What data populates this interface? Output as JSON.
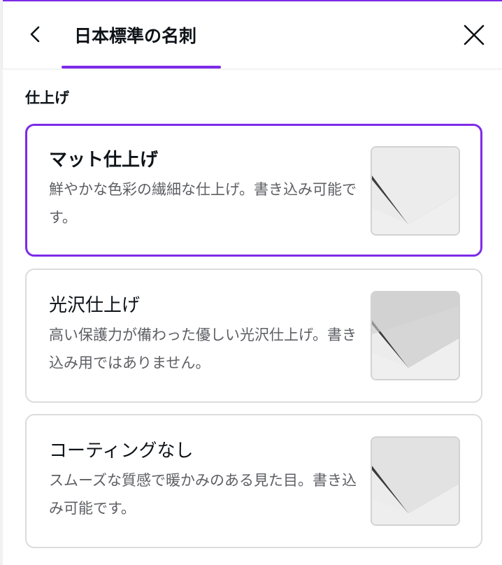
{
  "header": {
    "title": "日本標準の名刺",
    "back_icon": "chevron-left-icon",
    "close_icon": "close-icon",
    "accent_color": "#7d2ae8"
  },
  "section": {
    "label": "仕上げ"
  },
  "options": [
    {
      "title": "マット仕上げ",
      "description": "鮮やかな色彩の繊細な仕上げ。書き込み可能です。",
      "selected": true,
      "thumbnail": "matte-paper-image"
    },
    {
      "title": "光沢仕上げ",
      "description": "高い保護力が備わった優しい光沢仕上げ。書き込み用ではありません。",
      "selected": false,
      "thumbnail": "glossy-paper-image"
    },
    {
      "title": "コーティングなし",
      "description": "スムーズな質感で暖かみのある見た目。書き込み可能です。",
      "selected": false,
      "thumbnail": "uncoated-paper-image"
    }
  ]
}
